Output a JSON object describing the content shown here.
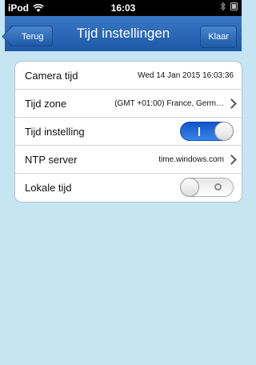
{
  "status_bar": {
    "device": "iPod",
    "time": "16:03",
    "icons": [
      "wifi-icon",
      "bluetooth-icon",
      "battery-icon"
    ]
  },
  "nav": {
    "back_label": "Terug",
    "title": "Tijd instellingen",
    "done_label": "Klaar"
  },
  "settings": {
    "camera_time": {
      "label": "Camera tijd",
      "value": "Wed 14 Jan 2015 16:03:36"
    },
    "timezone": {
      "label": "Tijd zone",
      "value": "(GMT +01:00) France, Germ…"
    },
    "time_setting": {
      "label": "Tijd instelling",
      "toggle": "on"
    },
    "ntp_server": {
      "label": "NTP server",
      "value": "time.windows.com"
    },
    "local_time": {
      "label": "Lokale tijd",
      "toggle": "off"
    }
  },
  "colors": {
    "nav_blue": "#2a67b8",
    "background": "#c5e5f2",
    "toggle_on": "#1a62d6"
  }
}
